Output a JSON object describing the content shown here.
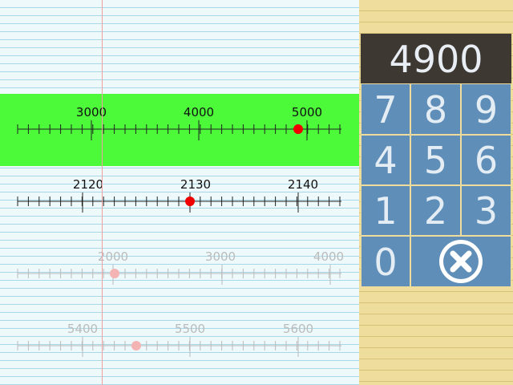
{
  "display": {
    "value": "4900"
  },
  "keypad": {
    "keys": [
      "7",
      "8",
      "9",
      "4",
      "5",
      "6",
      "1",
      "2",
      "3",
      "0"
    ],
    "clear_icon": "close-circle-icon"
  },
  "number_lines": [
    {
      "labels": [
        "3000",
        "4000",
        "5000"
      ],
      "highlighted": true,
      "marker_color": "#f00000",
      "faded": false
    },
    {
      "labels": [
        "2120",
        "2130",
        "2140"
      ],
      "highlighted": false,
      "marker_color": "#f00000",
      "faded": false
    },
    {
      "labels": [
        "2000",
        "3000",
        "4000"
      ],
      "highlighted": false,
      "marker_color": "#f5b4b4",
      "faded": true
    },
    {
      "labels": [
        "5400",
        "5500",
        "5600"
      ],
      "highlighted": false,
      "marker_color": "#f5b4b4",
      "faded": true
    }
  ],
  "colors": {
    "highlight": "#4cfa3a",
    "keypad": "#5f8fb8",
    "display": "#3e3832"
  }
}
